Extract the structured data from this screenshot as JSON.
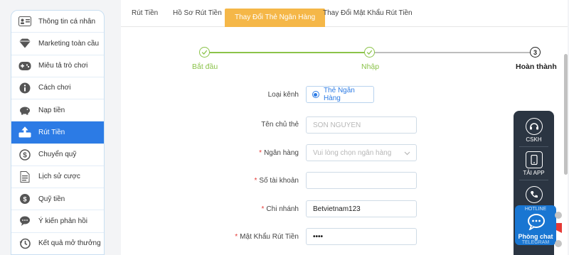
{
  "sidebar": {
    "items": [
      {
        "label": "Thông tin cá nhân",
        "icon": "id-card-icon",
        "active": false
      },
      {
        "label": "Marketing toàn cầu",
        "icon": "diamond-icon",
        "active": false
      },
      {
        "label": "Miêu tả trò chơi",
        "icon": "gamepad-icon",
        "active": false
      },
      {
        "label": "Cách chơi",
        "icon": "info-icon",
        "active": false
      },
      {
        "label": "Nạp tiền",
        "icon": "piggy-bank-icon",
        "active": false
      },
      {
        "label": "Rút Tiền",
        "icon": "withdraw-icon",
        "active": true
      },
      {
        "label": "Chuyển quỹ",
        "icon": "dollar-coin-icon",
        "active": false
      },
      {
        "label": "Lịch sử cược",
        "icon": "document-icon",
        "active": false
      },
      {
        "label": "Quỹ tiền",
        "icon": "coins-icon",
        "active": false
      },
      {
        "label": "Ý kiến phản hồi",
        "icon": "chat-icon",
        "active": false
      },
      {
        "label": "Kết quả mở thưởng",
        "icon": "history-icon",
        "active": false
      }
    ]
  },
  "tabs": [
    {
      "label": "Rút Tiền",
      "active": false
    },
    {
      "label": "Hồ Sơ Rút Tiền",
      "active": false
    },
    {
      "label": "Thay Đổi Thẻ Ngân Hàng",
      "active": true
    },
    {
      "label": "Thay Đổi Mật Khẩu Rút Tiền",
      "active": false
    }
  ],
  "stepper": {
    "steps": [
      {
        "label": "Bắt đầu",
        "state": "done"
      },
      {
        "label": "Nhập",
        "state": "done"
      },
      {
        "label": "Hoàn thành",
        "state": "current",
        "number": "3"
      }
    ]
  },
  "form": {
    "channel_label": "Loại kênh",
    "channel_value": "Thẻ Ngân Hàng",
    "holder_label": "Tên chủ thẻ",
    "holder_placeholder": "SON NGUYEN",
    "bank_label": "Ngân hàng",
    "bank_placeholder": "Vui lòng chọn ngân hàng",
    "account_label": "Số tài khoản",
    "account_value": "",
    "branch_label": "Chi nhánh",
    "branch_value": "Betvietnam123",
    "password_label": "Mật Khẩu Rút Tiền",
    "password_value": "••••",
    "required_mark": "*"
  },
  "float_panel": {
    "cskh_label": "CSKH",
    "app_label": "TẢI APP",
    "hotline_label": "HOTLINE",
    "telegram_title": "Phòng chat",
    "telegram_sub": "TELEGRAM"
  },
  "colors": {
    "accent": "#2c7be5",
    "tab_active": "#f5b748",
    "step_done": "#8bc34a",
    "panel_bg": "#2b3542",
    "telegram_bg": "#1976d2"
  }
}
